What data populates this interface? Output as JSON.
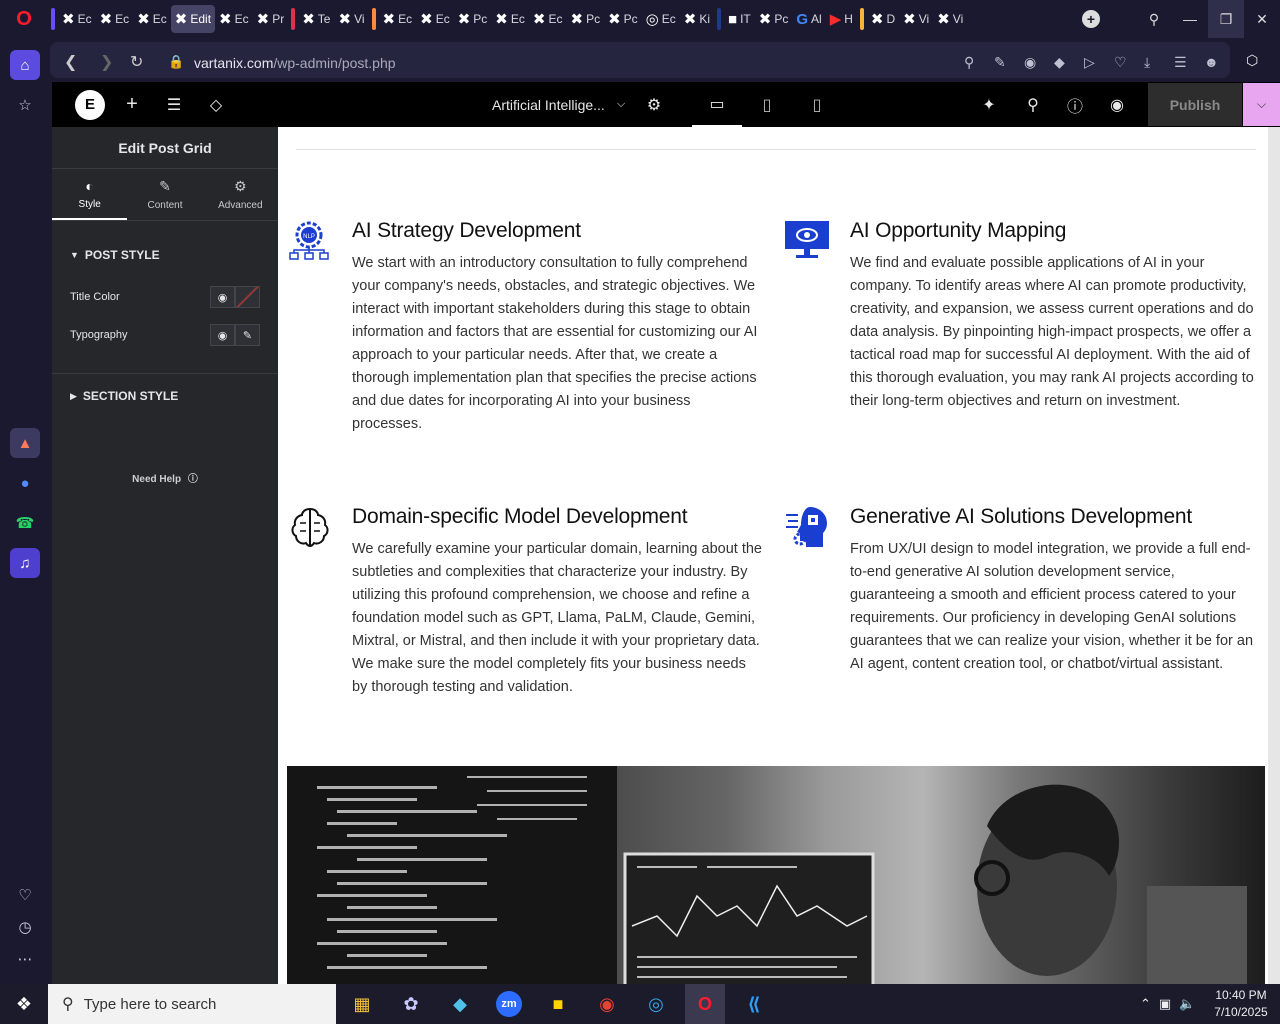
{
  "browser": {
    "url_domain": "vartanix.com",
    "url_path": "/wp-admin/post.php",
    "tabs": [
      {
        "label": "Ec",
        "icon": "x-icon"
      },
      {
        "label": "Ec",
        "icon": "x-icon"
      },
      {
        "label": "Ec",
        "icon": "x-icon"
      },
      {
        "label": "Edit",
        "icon": "x-icon",
        "active": true
      },
      {
        "label": "Ec",
        "icon": "x-icon"
      },
      {
        "label": "Pr",
        "icon": "x-icon"
      },
      {
        "label": "Te",
        "icon": "x-icon"
      },
      {
        "label": "Vi",
        "icon": "x-icon"
      },
      {
        "label": "Ec",
        "icon": "x-icon"
      },
      {
        "label": "Ec",
        "icon": "x-icon"
      },
      {
        "label": "Pc",
        "icon": "x-icon"
      },
      {
        "label": "Ec",
        "icon": "x-icon"
      },
      {
        "label": "Ec",
        "icon": "x-icon"
      },
      {
        "label": "Pc",
        "icon": "x-icon"
      },
      {
        "label": "Pc",
        "icon": "x-icon"
      },
      {
        "label": "Ec",
        "icon": "globe-icon"
      },
      {
        "label": "Ki",
        "icon": "x-icon"
      },
      {
        "label": "IT",
        "icon": "doc-icon"
      },
      {
        "label": "Pc",
        "icon": "x-icon"
      },
      {
        "label": "Al",
        "icon": "google-icon"
      },
      {
        "label": "H",
        "icon": "youtube-icon"
      },
      {
        "label": "D",
        "icon": "x-icon"
      },
      {
        "label": "Vi",
        "icon": "x-icon"
      },
      {
        "label": "Vi",
        "icon": "x-icon"
      }
    ]
  },
  "editor": {
    "page_selector": "Artificial Intellige...",
    "publish_label": "Publish",
    "panel": {
      "title": "Edit Post Grid",
      "tabs": [
        {
          "label": "Style",
          "icon": "style-icon"
        },
        {
          "label": "Content",
          "icon": "pencil-icon"
        },
        {
          "label": "Advanced",
          "icon": "gear-icon"
        }
      ],
      "post_style_label": "POST STYLE",
      "title_color_label": "Title Color",
      "typography_label": "Typography",
      "section_style_label": "SECTION STYLE",
      "need_help_label": "Need Help"
    }
  },
  "content": {
    "cards": [
      {
        "title": "AI Strategy Development",
        "text": "We start with an introductory consultation to fully comprehend your company's needs, obstacles, and strategic objectives. We interact with important stakeholders during this stage to obtain information and factors that are essential for customizing our AI approach to your particular needs. After that, we create a thorough implementation plan that specifies the precise actions and due dates for incorporating AI into your business processes.",
        "icon": "nlp-gear-icon"
      },
      {
        "title": "AI Opportunity Mapping",
        "text": "We find and evaluate possible applications of AI in your company. To identify areas where AI can promote productivity, creativity, and expansion, we assess current operations and do data analysis. By pinpointing high-impact prospects, we offer a tactical road map for successful AI deployment. With the aid of this thorough evaluation, you may rank AI projects according to their long-term objectives and return on investment.",
        "icon": "monitor-eye-icon"
      },
      {
        "title": "Domain-specific Model Development",
        "text": "We carefully examine your particular domain, learning about the subtleties and complexities that characterize your industry. By utilizing this profound comprehension, we choose and refine a foundation model such as GPT, Llama, PaLM, Claude, Gemini, Mixtral, or Mistral, and then include it with your proprietary data. We make sure the model completely fits your business needs by thorough testing and validation.",
        "icon": "brain-icon"
      },
      {
        "title": "Generative AI Solutions Development",
        "text": "From UX/UI design to model integration, we provide a full end-to-end generative AI solution development service, guaranteeing a smooth and efficient process catered to your requirements. Our proficiency in developing GenAI solutions guarantees that we can realize your vision, whether it be for an AI agent, content creation tool, or chatbot/virtual assistant.",
        "icon": "ai-head-gear-icon"
      }
    ]
  },
  "taskbar": {
    "search_placeholder": "Type here to search",
    "time": "10:40 PM",
    "date": "7/10/2025"
  }
}
